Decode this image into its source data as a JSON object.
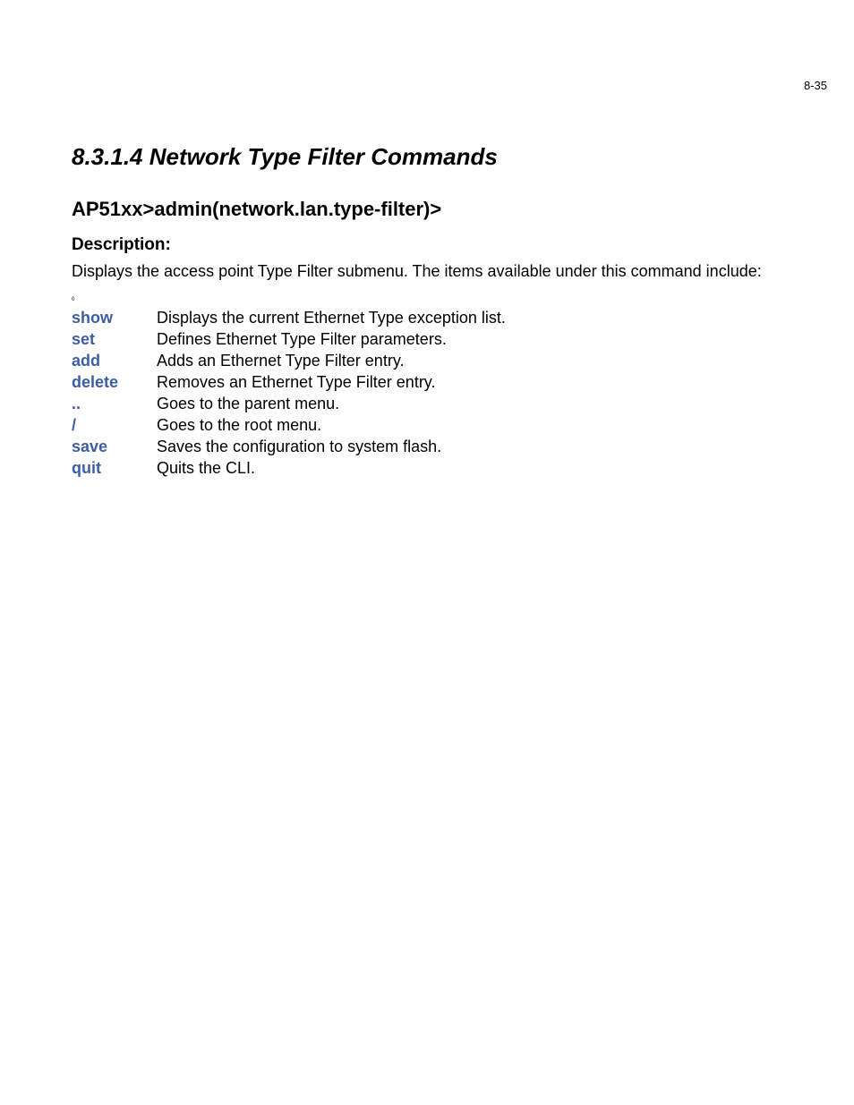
{
  "page_number": "8-35",
  "section_title": "8.3.1.4  Network Type Filter Commands",
  "prompt": "AP51xx>admin(network.lan.type-filter)>",
  "description_label": "Description:",
  "description_text": "Displays the access point Type Filter submenu. The items available under this command include:",
  "tiny_mark": "0",
  "commands": [
    {
      "cmd": "show",
      "desc": "Displays the current Ethernet Type exception list."
    },
    {
      "cmd": "set",
      "desc": "Defines Ethernet Type Filter parameters."
    },
    {
      "cmd": "add",
      "desc": "Adds an Ethernet Type Filter entry."
    },
    {
      "cmd": "delete",
      "desc": "Removes an Ethernet Type Filter entry."
    },
    {
      "cmd": "..",
      "desc": "Goes to the parent menu."
    },
    {
      "cmd": "/",
      "desc": "Goes to the root menu."
    },
    {
      "cmd": "save",
      "desc": "Saves the configuration to system flash."
    },
    {
      "cmd": "quit",
      "desc": "Quits the CLI."
    }
  ]
}
